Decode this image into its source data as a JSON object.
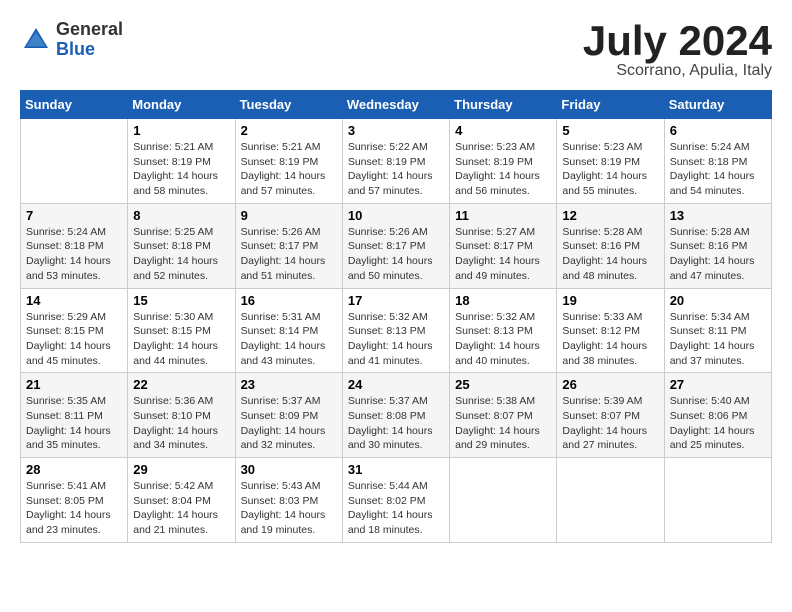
{
  "logo": {
    "general": "General",
    "blue": "Blue"
  },
  "title": "July 2024",
  "subtitle": "Scorrano, Apulia, Italy",
  "days_of_week": [
    "Sunday",
    "Monday",
    "Tuesday",
    "Wednesday",
    "Thursday",
    "Friday",
    "Saturday"
  ],
  "weeks": [
    [
      {
        "day": "",
        "sunrise": "",
        "sunset": "",
        "daylight": ""
      },
      {
        "day": "1",
        "sunrise": "Sunrise: 5:21 AM",
        "sunset": "Sunset: 8:19 PM",
        "daylight": "Daylight: 14 hours and 58 minutes."
      },
      {
        "day": "2",
        "sunrise": "Sunrise: 5:21 AM",
        "sunset": "Sunset: 8:19 PM",
        "daylight": "Daylight: 14 hours and 57 minutes."
      },
      {
        "day": "3",
        "sunrise": "Sunrise: 5:22 AM",
        "sunset": "Sunset: 8:19 PM",
        "daylight": "Daylight: 14 hours and 57 minutes."
      },
      {
        "day": "4",
        "sunrise": "Sunrise: 5:23 AM",
        "sunset": "Sunset: 8:19 PM",
        "daylight": "Daylight: 14 hours and 56 minutes."
      },
      {
        "day": "5",
        "sunrise": "Sunrise: 5:23 AM",
        "sunset": "Sunset: 8:19 PM",
        "daylight": "Daylight: 14 hours and 55 minutes."
      },
      {
        "day": "6",
        "sunrise": "Sunrise: 5:24 AM",
        "sunset": "Sunset: 8:18 PM",
        "daylight": "Daylight: 14 hours and 54 minutes."
      }
    ],
    [
      {
        "day": "7",
        "sunrise": "Sunrise: 5:24 AM",
        "sunset": "Sunset: 8:18 PM",
        "daylight": "Daylight: 14 hours and 53 minutes."
      },
      {
        "day": "8",
        "sunrise": "Sunrise: 5:25 AM",
        "sunset": "Sunset: 8:18 PM",
        "daylight": "Daylight: 14 hours and 52 minutes."
      },
      {
        "day": "9",
        "sunrise": "Sunrise: 5:26 AM",
        "sunset": "Sunset: 8:17 PM",
        "daylight": "Daylight: 14 hours and 51 minutes."
      },
      {
        "day": "10",
        "sunrise": "Sunrise: 5:26 AM",
        "sunset": "Sunset: 8:17 PM",
        "daylight": "Daylight: 14 hours and 50 minutes."
      },
      {
        "day": "11",
        "sunrise": "Sunrise: 5:27 AM",
        "sunset": "Sunset: 8:17 PM",
        "daylight": "Daylight: 14 hours and 49 minutes."
      },
      {
        "day": "12",
        "sunrise": "Sunrise: 5:28 AM",
        "sunset": "Sunset: 8:16 PM",
        "daylight": "Daylight: 14 hours and 48 minutes."
      },
      {
        "day": "13",
        "sunrise": "Sunrise: 5:28 AM",
        "sunset": "Sunset: 8:16 PM",
        "daylight": "Daylight: 14 hours and 47 minutes."
      }
    ],
    [
      {
        "day": "14",
        "sunrise": "Sunrise: 5:29 AM",
        "sunset": "Sunset: 8:15 PM",
        "daylight": "Daylight: 14 hours and 45 minutes."
      },
      {
        "day": "15",
        "sunrise": "Sunrise: 5:30 AM",
        "sunset": "Sunset: 8:15 PM",
        "daylight": "Daylight: 14 hours and 44 minutes."
      },
      {
        "day": "16",
        "sunrise": "Sunrise: 5:31 AM",
        "sunset": "Sunset: 8:14 PM",
        "daylight": "Daylight: 14 hours and 43 minutes."
      },
      {
        "day": "17",
        "sunrise": "Sunrise: 5:32 AM",
        "sunset": "Sunset: 8:13 PM",
        "daylight": "Daylight: 14 hours and 41 minutes."
      },
      {
        "day": "18",
        "sunrise": "Sunrise: 5:32 AM",
        "sunset": "Sunset: 8:13 PM",
        "daylight": "Daylight: 14 hours and 40 minutes."
      },
      {
        "day": "19",
        "sunrise": "Sunrise: 5:33 AM",
        "sunset": "Sunset: 8:12 PM",
        "daylight": "Daylight: 14 hours and 38 minutes."
      },
      {
        "day": "20",
        "sunrise": "Sunrise: 5:34 AM",
        "sunset": "Sunset: 8:11 PM",
        "daylight": "Daylight: 14 hours and 37 minutes."
      }
    ],
    [
      {
        "day": "21",
        "sunrise": "Sunrise: 5:35 AM",
        "sunset": "Sunset: 8:11 PM",
        "daylight": "Daylight: 14 hours and 35 minutes."
      },
      {
        "day": "22",
        "sunrise": "Sunrise: 5:36 AM",
        "sunset": "Sunset: 8:10 PM",
        "daylight": "Daylight: 14 hours and 34 minutes."
      },
      {
        "day": "23",
        "sunrise": "Sunrise: 5:37 AM",
        "sunset": "Sunset: 8:09 PM",
        "daylight": "Daylight: 14 hours and 32 minutes."
      },
      {
        "day": "24",
        "sunrise": "Sunrise: 5:37 AM",
        "sunset": "Sunset: 8:08 PM",
        "daylight": "Daylight: 14 hours and 30 minutes."
      },
      {
        "day": "25",
        "sunrise": "Sunrise: 5:38 AM",
        "sunset": "Sunset: 8:07 PM",
        "daylight": "Daylight: 14 hours and 29 minutes."
      },
      {
        "day": "26",
        "sunrise": "Sunrise: 5:39 AM",
        "sunset": "Sunset: 8:07 PM",
        "daylight": "Daylight: 14 hours and 27 minutes."
      },
      {
        "day": "27",
        "sunrise": "Sunrise: 5:40 AM",
        "sunset": "Sunset: 8:06 PM",
        "daylight": "Daylight: 14 hours and 25 minutes."
      }
    ],
    [
      {
        "day": "28",
        "sunrise": "Sunrise: 5:41 AM",
        "sunset": "Sunset: 8:05 PM",
        "daylight": "Daylight: 14 hours and 23 minutes."
      },
      {
        "day": "29",
        "sunrise": "Sunrise: 5:42 AM",
        "sunset": "Sunset: 8:04 PM",
        "daylight": "Daylight: 14 hours and 21 minutes."
      },
      {
        "day": "30",
        "sunrise": "Sunrise: 5:43 AM",
        "sunset": "Sunset: 8:03 PM",
        "daylight": "Daylight: 14 hours and 19 minutes."
      },
      {
        "day": "31",
        "sunrise": "Sunrise: 5:44 AM",
        "sunset": "Sunset: 8:02 PM",
        "daylight": "Daylight: 14 hours and 18 minutes."
      },
      {
        "day": "",
        "sunrise": "",
        "sunset": "",
        "daylight": ""
      },
      {
        "day": "",
        "sunrise": "",
        "sunset": "",
        "daylight": ""
      },
      {
        "day": "",
        "sunrise": "",
        "sunset": "",
        "daylight": ""
      }
    ]
  ]
}
